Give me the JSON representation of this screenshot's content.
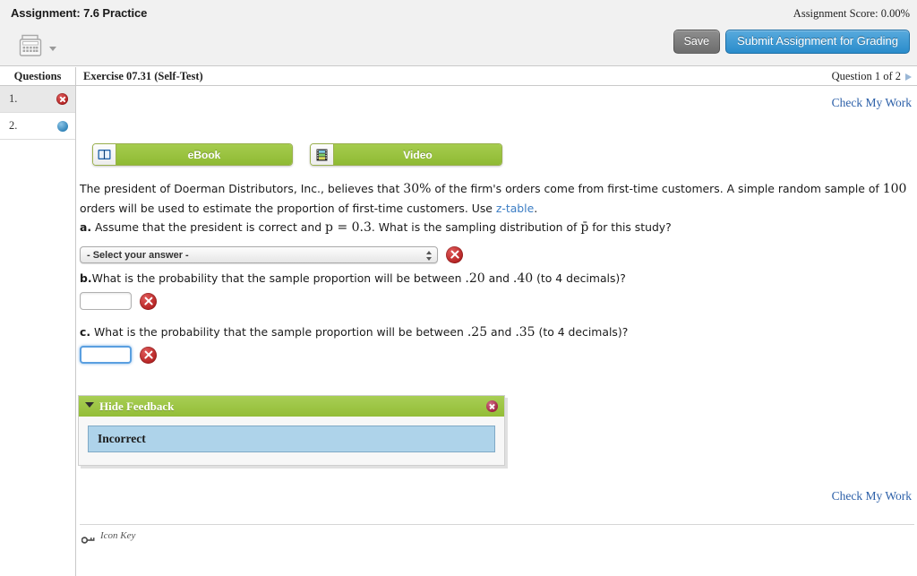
{
  "header": {
    "assignment_title": "Assignment: 7.6 Practice",
    "assignment_score": "Assignment Score: 0.00%",
    "calculator_icon": "calculator-icon",
    "save_label": "Save",
    "submit_label": "Submit Assignment for Grading"
  },
  "exercise_bar": {
    "title": "Exercise 07.31 (Self-Test)",
    "question_nav": "Question 1 of 2"
  },
  "sidebar": {
    "heading": "Questions",
    "items": [
      {
        "label": "1.",
        "status": "incorrect",
        "status_icon": "red-x-icon",
        "active": true
      },
      {
        "label": "2.",
        "status": "unanswered",
        "status_icon": "blue-dot-icon",
        "active": false
      }
    ]
  },
  "main": {
    "check_my_work_top": "Check My Work",
    "check_my_work_bottom": "Check My Work",
    "media": {
      "ebook_label": "eBook",
      "ebook_icon": "book-icon",
      "video_label": "Video",
      "video_icon": "film-strip-icon"
    },
    "question": {
      "stem_1": "The president of Doerman Distributors, Inc., believes that ",
      "stem_pct": "30%",
      "stem_2": " of the firm's orders come from first-time customers. A simple random sample of ",
      "stem_n": "100",
      "stem_3": " orders will be used to estimate the proportion of first-time customers. Use ",
      "stem_link": "z-table",
      "stem_4": ".",
      "part_a_letter": "a.",
      "part_a_1": " Assume that the president is correct and ",
      "part_a_math": "p = 0.3",
      "part_a_2": ". What is the sampling distribution of ",
      "part_a_phat": "p̄",
      "part_a_3": " for this study?",
      "part_b_letter": "b.",
      "part_b_1": "What is the probability that the sample proportion will be between ",
      "part_b_lo": ".20",
      "part_b_mid": " and ",
      "part_b_hi": ".40",
      "part_b_2": " (to 4 decimals)?",
      "part_c_letter": "c.",
      "part_c_1": " What is the probability that the sample proportion will be between ",
      "part_c_lo": ".25",
      "part_c_mid": " and ",
      "part_c_hi": ".35",
      "part_c_2": " (to 4 decimals)?"
    },
    "answers": {
      "select_value": "- Select your answer -",
      "select_status_icon": "red-x-icon",
      "input_b_value": "",
      "input_b_status_icon": "red-x-icon",
      "input_c_value": "",
      "input_c_status_icon": "red-x-icon"
    },
    "feedback": {
      "toggle_label": "Hide Feedback",
      "close_icon": "close-icon",
      "message": "Incorrect"
    },
    "icon_key": {
      "label": "Icon Key",
      "icon": "key-icon"
    }
  },
  "colors": {
    "accent_green": "#93bd37",
    "accent_blue": "#2a8ccb",
    "link_blue": "#2b5fa8",
    "status_red": "#b32020",
    "status_blue": "#2b7fb5",
    "feedback_box": "#aed3ea",
    "topbar_bg": "#f1f1f1"
  }
}
